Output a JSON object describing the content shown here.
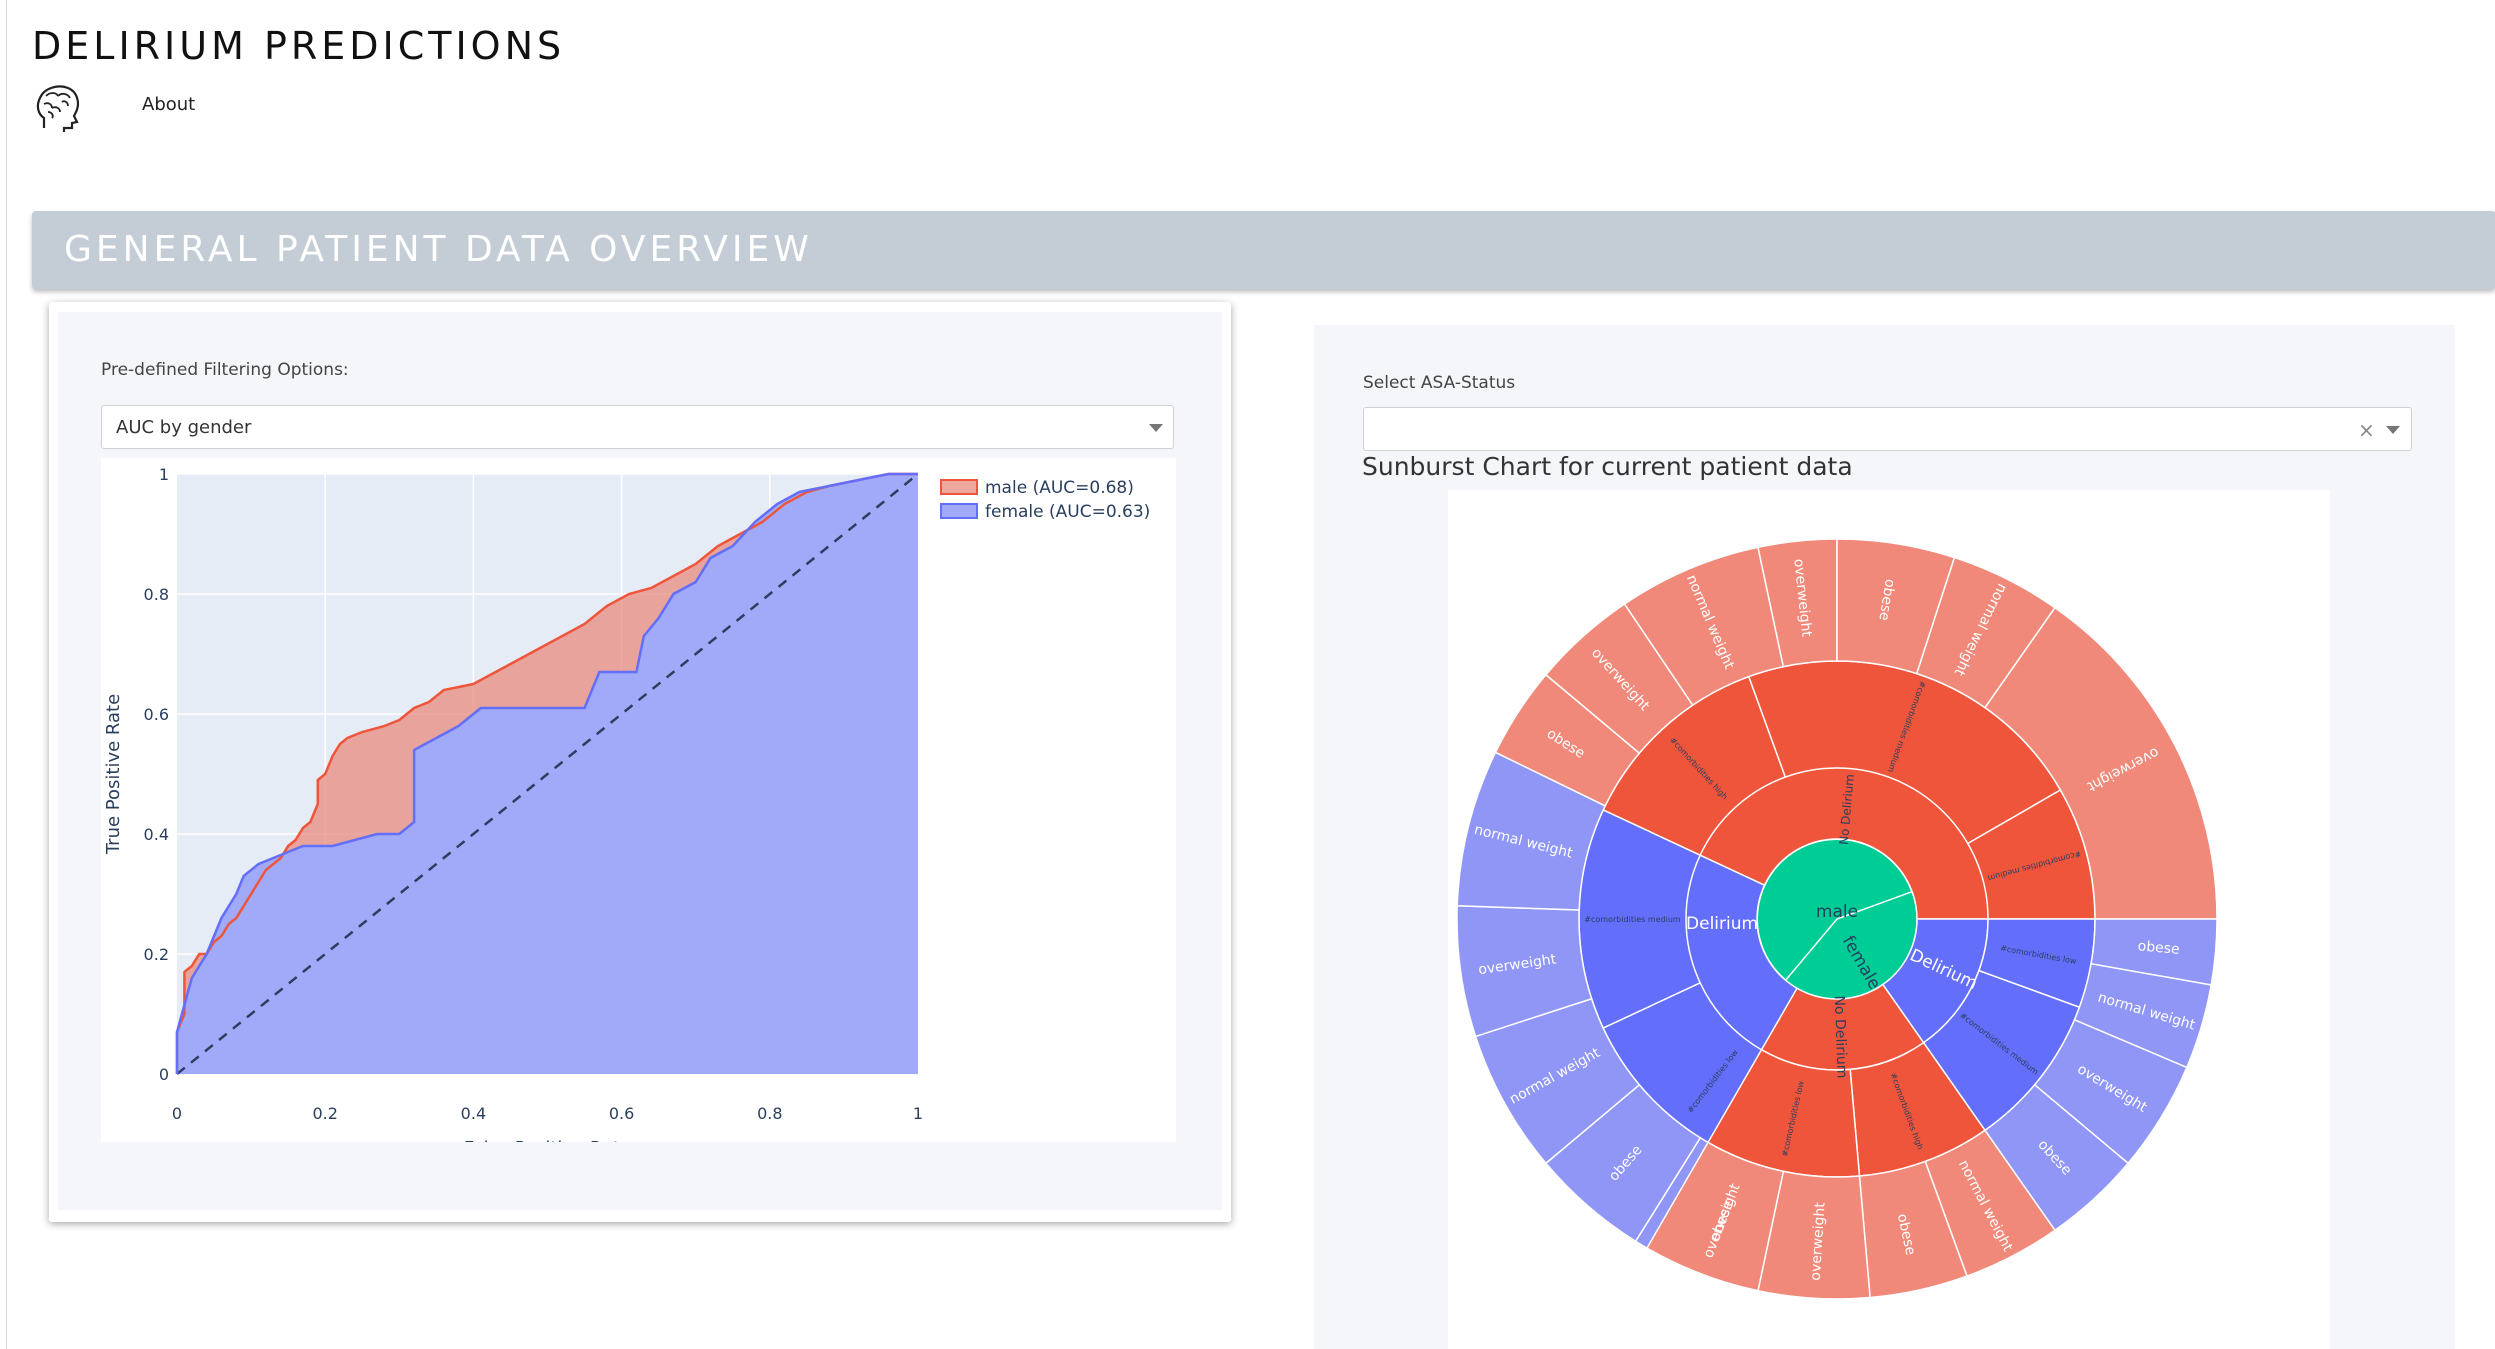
{
  "app": {
    "title": "DELIRIUM PREDICTIONS",
    "nav_about": "About"
  },
  "section": {
    "title": "GENERAL PATIENT DATA OVERVIEW"
  },
  "filter": {
    "label": "Pre-defined Filtering Options:",
    "selected": "AUC by gender"
  },
  "asa": {
    "label": "Select ASA-Status",
    "selected": ""
  },
  "sunburst_title": "Sunburst Chart for current patient data",
  "icons": {
    "logo": "brain-head-icon",
    "caret": "chevron-down-icon",
    "clear": "close-icon"
  },
  "chart_data": [
    {
      "type": "line",
      "xlabel": "False Positive Rate",
      "ylabel": "True Positive Rate",
      "xlim": [
        0,
        1
      ],
      "ylim": [
        0,
        1
      ],
      "xticks": [
        "0",
        "0.2",
        "0.4",
        "0.6",
        "0.8",
        "1"
      ],
      "yticks": [
        "0",
        "0.2",
        "0.4",
        "0.6",
        "0.8",
        "1"
      ],
      "grid": true,
      "legend_position": "top-right",
      "series": [
        {
          "name": "male (AUC=0.68)",
          "color": "#ef553b",
          "points": [
            [
              0,
              0
            ],
            [
              0,
              0.07
            ],
            [
              0.01,
              0.1
            ],
            [
              0.01,
              0.17
            ],
            [
              0.02,
              0.18
            ],
            [
              0.03,
              0.2
            ],
            [
              0.04,
              0.2
            ],
            [
              0.05,
              0.22
            ],
            [
              0.06,
              0.23
            ],
            [
              0.07,
              0.25
            ],
            [
              0.08,
              0.26
            ],
            [
              0.09,
              0.28
            ],
            [
              0.1,
              0.3
            ],
            [
              0.11,
              0.32
            ],
            [
              0.12,
              0.34
            ],
            [
              0.13,
              0.35
            ],
            [
              0.14,
              0.36
            ],
            [
              0.15,
              0.38
            ],
            [
              0.16,
              0.39
            ],
            [
              0.17,
              0.41
            ],
            [
              0.18,
              0.42
            ],
            [
              0.19,
              0.45
            ],
            [
              0.19,
              0.49
            ],
            [
              0.2,
              0.5
            ],
            [
              0.21,
              0.53
            ],
            [
              0.22,
              0.55
            ],
            [
              0.23,
              0.56
            ],
            [
              0.25,
              0.57
            ],
            [
              0.28,
              0.58
            ],
            [
              0.3,
              0.59
            ],
            [
              0.32,
              0.61
            ],
            [
              0.34,
              0.62
            ],
            [
              0.36,
              0.64
            ],
            [
              0.4,
              0.65
            ],
            [
              0.43,
              0.67
            ],
            [
              0.46,
              0.69
            ],
            [
              0.49,
              0.71
            ],
            [
              0.52,
              0.73
            ],
            [
              0.55,
              0.75
            ],
            [
              0.58,
              0.78
            ],
            [
              0.61,
              0.8
            ],
            [
              0.64,
              0.81
            ],
            [
              0.67,
              0.83
            ],
            [
              0.7,
              0.85
            ],
            [
              0.73,
              0.88
            ],
            [
              0.76,
              0.9
            ],
            [
              0.79,
              0.92
            ],
            [
              0.82,
              0.95
            ],
            [
              0.85,
              0.97
            ],
            [
              0.88,
              0.98
            ],
            [
              0.92,
              0.99
            ],
            [
              0.96,
              1
            ],
            [
              1,
              1
            ]
          ]
        },
        {
          "name": "female (AUC=0.63)",
          "color": "#636efa",
          "points": [
            [
              0,
              0
            ],
            [
              0,
              0.07
            ],
            [
              0.02,
              0.16
            ],
            [
              0.04,
              0.2
            ],
            [
              0.06,
              0.26
            ],
            [
              0.08,
              0.3
            ],
            [
              0.09,
              0.33
            ],
            [
              0.11,
              0.35
            ],
            [
              0.13,
              0.36
            ],
            [
              0.15,
              0.37
            ],
            [
              0.17,
              0.38
            ],
            [
              0.19,
              0.38
            ],
            [
              0.21,
              0.38
            ],
            [
              0.24,
              0.39
            ],
            [
              0.27,
              0.4
            ],
            [
              0.3,
              0.4
            ],
            [
              0.32,
              0.42
            ],
            [
              0.32,
              0.54
            ],
            [
              0.35,
              0.56
            ],
            [
              0.38,
              0.58
            ],
            [
              0.41,
              0.61
            ],
            [
              0.45,
              0.61
            ],
            [
              0.5,
              0.61
            ],
            [
              0.55,
              0.61
            ],
            [
              0.57,
              0.67
            ],
            [
              0.62,
              0.67
            ],
            [
              0.63,
              0.73
            ],
            [
              0.65,
              0.76
            ],
            [
              0.67,
              0.8
            ],
            [
              0.7,
              0.82
            ],
            [
              0.72,
              0.86
            ],
            [
              0.75,
              0.88
            ],
            [
              0.78,
              0.92
            ],
            [
              0.81,
              0.95
            ],
            [
              0.84,
              0.97
            ],
            [
              0.88,
              0.98
            ],
            [
              0.92,
              0.99
            ],
            [
              0.96,
              1
            ],
            [
              1,
              1
            ]
          ]
        }
      ]
    },
    {
      "type": "sunburst",
      "root_label": "male",
      "nodes": [
        {
          "label": "male",
          "color": "#00cc96",
          "value": 1
        },
        {
          "label": "female",
          "color": "#00cc96",
          "value": 1
        },
        {
          "label": "Delirium",
          "color": "#636efa",
          "value": 1
        },
        {
          "label": "No Delirium",
          "color": "#ef553b",
          "value": 1
        },
        {
          "label": "obese",
          "color": "#f0897a",
          "value": 1
        },
        {
          "label": "overweight",
          "color": "#f0897a",
          "value": 1
        },
        {
          "label": "normal weight",
          "color": "#f0897a",
          "value": 1
        }
      ],
      "labels": [
        "male",
        "female",
        "Delirium",
        "No Delirium",
        "obese",
        "overweight",
        "normal weight",
        "#comorbidities high",
        "#comorbidities medium",
        "#comorbidities low"
      ]
    }
  ]
}
